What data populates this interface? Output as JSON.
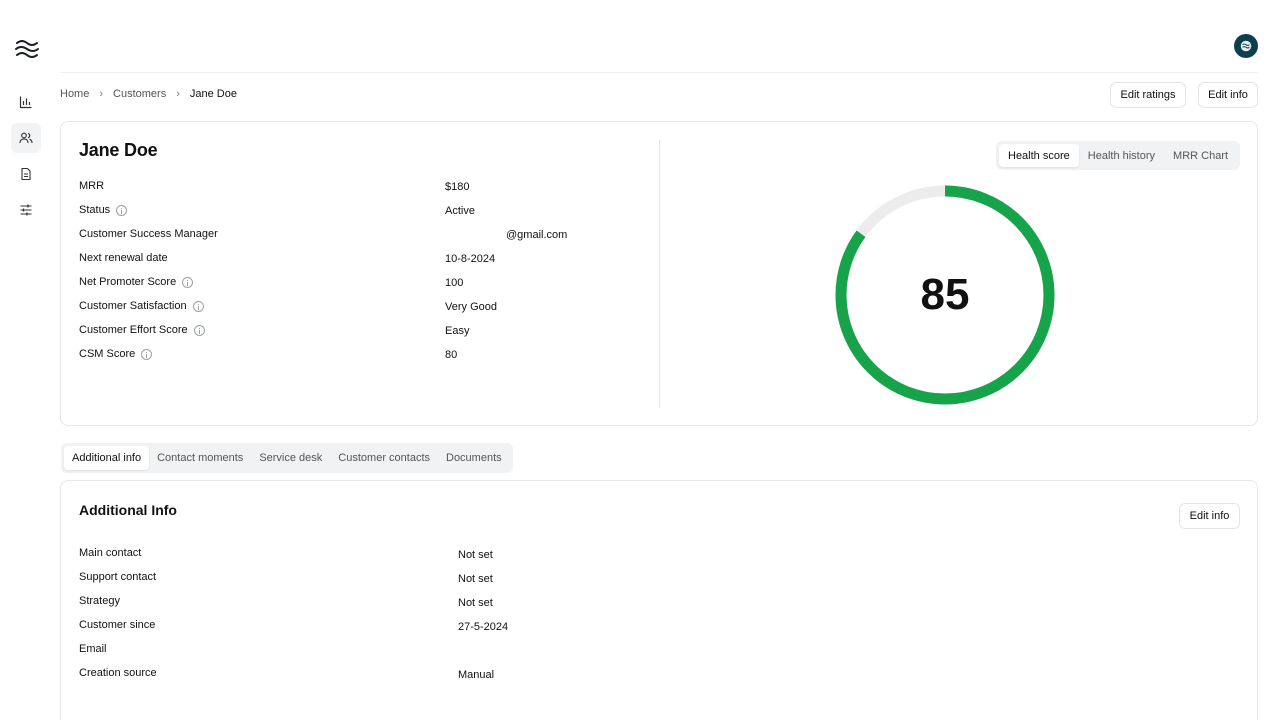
{
  "sidebar": {
    "logo_icon": "waves-logo-icon",
    "items": [
      {
        "icon": "bar-chart-icon",
        "name": "Dashboard"
      },
      {
        "icon": "users-icon",
        "name": "Customers",
        "active": true
      },
      {
        "icon": "document-icon",
        "name": "Documents"
      },
      {
        "icon": "sliders-icon",
        "name": "Settings"
      }
    ]
  },
  "header": {
    "avatar_icon": "avatar-logo-icon"
  },
  "breadcrumb": {
    "items": [
      "Home",
      "Customers",
      "Jane Doe"
    ]
  },
  "actions": {
    "edit_ratings": "Edit ratings",
    "edit_info": "Edit info"
  },
  "customer": {
    "name": "Jane Doe",
    "fields": [
      {
        "label": "MRR",
        "value": "$180",
        "info": false
      },
      {
        "label": "Status",
        "value": "Active",
        "info": true
      },
      {
        "label": "Customer Success Manager",
        "value": "@gmail.com",
        "info": false
      },
      {
        "label": "Next renewal date",
        "value": "10-8-2024",
        "info": false
      },
      {
        "label": "Net Promoter Score",
        "value": "100",
        "info": true
      },
      {
        "label": "Customer Satisfaction",
        "value": "Very Good",
        "info": true
      },
      {
        "label": "Customer Effort Score",
        "value": "Easy",
        "info": true
      },
      {
        "label": "CSM Score",
        "value": "80",
        "info": true
      }
    ]
  },
  "score_tabs": {
    "items": [
      "Health score",
      "Health history",
      "MRR Chart"
    ],
    "active": 0
  },
  "health": {
    "score": "85",
    "fraction": 0.85,
    "color": "#16a34a",
    "track_color": "#ececec"
  },
  "detail_tabs": {
    "items": [
      "Additional info",
      "Contact moments",
      "Service desk",
      "Customer contacts",
      "Documents"
    ],
    "active": 0
  },
  "additional_info": {
    "title": "Additional Info",
    "edit_label": "Edit info",
    "fields": [
      {
        "label": "Main contact",
        "value": "Not set"
      },
      {
        "label": "Support contact",
        "value": "Not set"
      },
      {
        "label": "Strategy",
        "value": "Not set"
      },
      {
        "label": "Customer since",
        "value": "27-5-2024"
      },
      {
        "label": "Email",
        "value": ""
      },
      {
        "label": "Creation source",
        "value": "Manual"
      }
    ]
  }
}
